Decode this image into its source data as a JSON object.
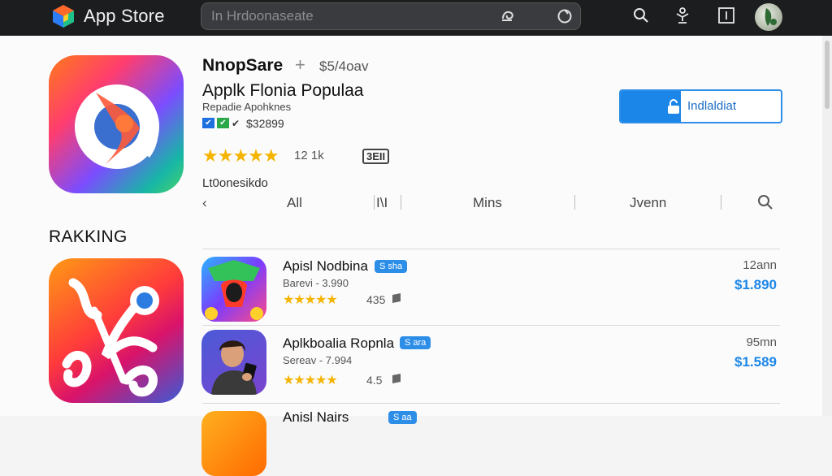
{
  "header": {
    "brand": "App Store",
    "search_text": "In Hrdoonaseate",
    "icons": [
      "logo-cube-icon",
      "mic-icon",
      "refresh-icon",
      "search-icon",
      "family-icon",
      "sidebar-toggle-icon",
      "avatar"
    ]
  },
  "app": {
    "name": "NnopSare",
    "plus": "+",
    "price": "$5/4oav",
    "subtitle": "Applk Flonia Populaa",
    "developer": "Repadie Apohknes",
    "badge_a": "✔",
    "badge_b": "✔",
    "badge_c": "✔",
    "size": "$32899",
    "stars": "★★★★★",
    "rating_count": "12 1k",
    "age_rating": "3EII",
    "install_label": "Indlaldiat",
    "section_label": "Lt0onesikdo"
  },
  "tabs": {
    "back": "‹",
    "all": "All",
    "charts": "I\\I",
    "mine": "Mins",
    "jvenn": "Jvenn"
  },
  "ranking": {
    "title": "RAKKING",
    "items": [
      {
        "title": "Apisl Nodbina",
        "tag": "S sha",
        "meta": "Barevi - 3.990",
        "stars": "★★★★★",
        "count": "435",
        "time": "12ann",
        "price": "$1.890"
      },
      {
        "title": "Aplkboalia Ropnla",
        "tag": "S ara",
        "meta": "Sereav - 7.994",
        "stars": "★★★★★",
        "count": "4.5",
        "time": "95mn",
        "price": "$1.589"
      },
      {
        "title": "Anisl Nairs",
        "tag": "S aa"
      }
    ]
  },
  "colors": {
    "accent": "#1b86e8",
    "star": "#f4b400",
    "topbar": "#1c1d1f"
  }
}
